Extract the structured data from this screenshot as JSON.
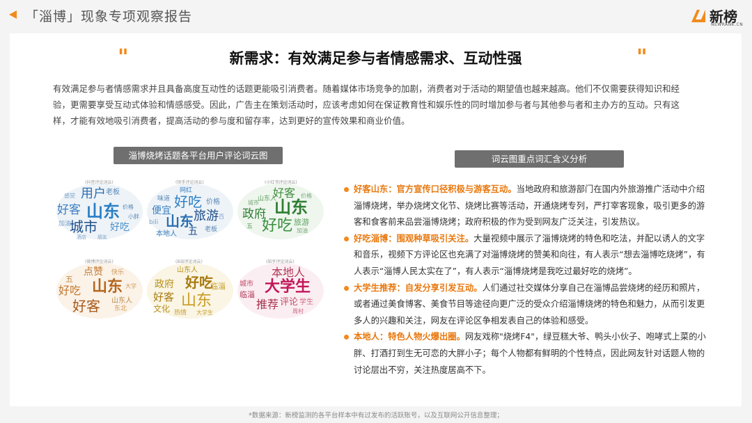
{
  "header": {
    "title": "「淄博」现象专项观察报告",
    "logo": {
      "cn": "新榜",
      "en": "NEWRANK.CN",
      "icon": "newrank-logo-icon"
    }
  },
  "main": {
    "quote_left": "\"",
    "quote_right": "\"",
    "title": "新需求：有效满足参与者情感需求、互动性强",
    "intro": "有效满足参与者情感需求并且具备高度互动性的话题更能吸引消费者。随着媒体市场竞争的加剧，消费者对于活动的期望值也越来越高。他们不仅需要获得知识和经验，更需要享受互动式体验和情感感受。因此，广告主在策划活动时，应该考虑如何在保证教育性和娱乐性的同时增加参与者与其他参与者和主办方的互动。只有这样，才能有效地吸引消费者，提高活动的参与度和留存率，达到更好的宣传效果和商业价值。"
  },
  "left_panel": {
    "label": "淄博烧烤话题各平台用户评论词云图",
    "clouds": [
      {
        "small": "(抖音评论词云)",
        "words": [
          "用户",
          "山东",
          "城市",
          "好客",
          "好吃",
          "老板",
          "加油",
          "感觉",
          "酒店",
          "朋友",
          "价格",
          "小胖"
        ]
      },
      {
        "small": "(快手评论词云)",
        "words": [
          "网红",
          "好吃",
          "味道",
          "便宜",
          "旅游",
          "山东",
          "价格",
          "本地人",
          "五",
          "bili",
          "老板",
          "百"
        ]
      },
      {
        "small": "(小红书评论词云)",
        "words": [
          "好客",
          "山东人",
          "山东",
          "政府",
          "好吃",
          "旅游",
          "五",
          "加油",
          "城市",
          "价格"
        ]
      },
      {
        "small": "(微博评论词云)",
        "words": [
          "点赞",
          "快乐",
          "五",
          "山东",
          "好吃",
          "好客",
          "山东人",
          "东北",
          "大学"
        ]
      },
      {
        "small": "(B站评论词云)",
        "words": [
          "山东人",
          "好吃",
          "政府",
          "山东",
          "好客",
          "文化",
          "临淄",
          "热情",
          "大学生"
        ]
      },
      {
        "small": "(知乎评论词云)",
        "words": [
          "本地人",
          "大学生",
          "推荐",
          "评论",
          "城市",
          "临淄",
          "学生",
          "周村"
        ]
      }
    ]
  },
  "right_panel": {
    "label": "词云图重点词汇含义分析",
    "items": [
      {
        "heading": "好客山东：官方宣传口径积极与游客互动。",
        "body": "当地政府和旅游部门在国内外旅游推广活动中介绍淄博烧烤，举办烧烤文化节、烧烤比赛等活动，开通烧烤专列，严打宰客现象，吸引更多的游客和食客前来品尝淄博烧烤；政府积极的作为受到网友广泛关注，引发热议。"
      },
      {
        "heading": "好吃淄博：围观种草吸引关注。",
        "body": "大量视频中展示了淄博烧烤的特色和吃法，并配以诱人的文字和音乐，视频下方评论区也充满了对淄博烧烤的赞美和向往，有人表示“想去淄博吃烧烤”，有人表示“淄博人民太实在了”，有人表示“淄博烧烤是我吃过最好吃的烧烤”。"
      },
      {
        "heading": "大学生推荐：自发分享引发互动。",
        "body": "人们通过社交媒体分享自己在淄博品尝烧烤的经历和照片，或者通过美食博客、美食节目等途径向更广泛的受众介绍淄博烧烤的特色和魅力，从而引发更多人的兴趣和关注，网友在评论区争相发表自己的体验和感受。"
      },
      {
        "heading": "本地人：特色人物火爆出圈。",
        "body": "网友戏称\"烧烤F4\"，绿豆糕大爷、鸭头小伙子、咆哮式上菜的小胖、打酒打到生无可恋的大胖小子；每个人物都有鲜明的个性特点，因此网友针对话题人物的讨论层出不穷，关注热度居高不下。"
      }
    ]
  },
  "footer": "*数据来源：新榜监测的各平台样本中有过发布的活跃账号，以及互联网公开信息整理；",
  "colors": {
    "accent": "#f28a1c",
    "pill": "#6f6f6f",
    "card": "#ffffff",
    "background": "#f4f4f4"
  }
}
